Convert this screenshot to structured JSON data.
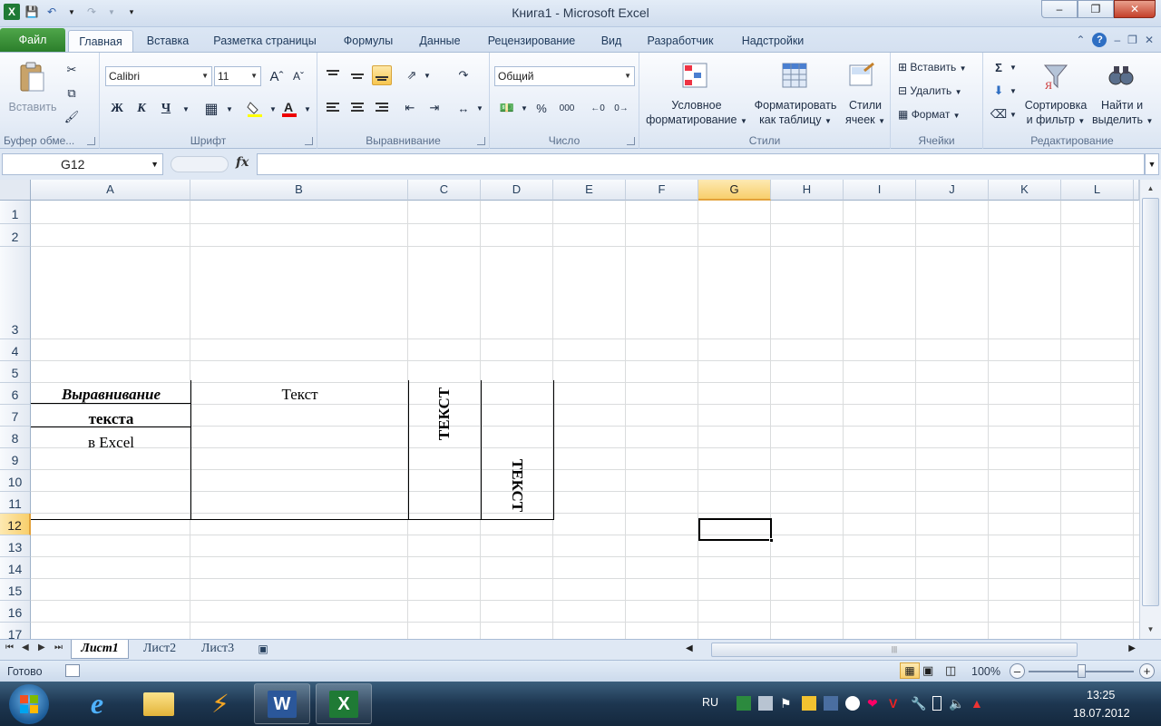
{
  "window": {
    "title": "Книга1 - Microsoft Excel",
    "min_glyph": "–",
    "restore_glyph": "❐",
    "close_glyph": "✕"
  },
  "tabs": [
    {
      "label": "Файл",
      "name": "tab-file"
    },
    {
      "label": "Главная",
      "name": "tab-home"
    },
    {
      "label": "Вставка",
      "name": "tab-insert"
    },
    {
      "label": "Разметка страницы",
      "name": "tab-page-layout"
    },
    {
      "label": "Формулы",
      "name": "tab-formulas"
    },
    {
      "label": "Данные",
      "name": "tab-data"
    },
    {
      "label": "Рецензирование",
      "name": "tab-review"
    },
    {
      "label": "Вид",
      "name": "tab-view"
    },
    {
      "label": "Разработчик",
      "name": "tab-developer"
    },
    {
      "label": "Надстройки",
      "name": "tab-addins"
    }
  ],
  "ribbon": {
    "clipboard": {
      "group_label": "Буфер обме...",
      "paste_label": "Вставить"
    },
    "font": {
      "group_label": "Шрифт",
      "font_name": "Calibri",
      "font_size": "11",
      "bold": "Ж",
      "italic": "К",
      "underline": "Ч"
    },
    "alignment": {
      "group_label": "Выравнивание"
    },
    "number": {
      "group_label": "Число",
      "format": "Общий",
      "percent": "%",
      "thousands": "000"
    },
    "styles": {
      "group_label": "Стили",
      "conditional_line1": "Условное",
      "conditional_line2": "форматирование",
      "table_line1": "Форматировать",
      "table_line2": "как таблицу",
      "cell_line1": "Стили",
      "cell_line2": "ячеек"
    },
    "cells": {
      "group_label": "Ячейки",
      "insert": "Вставить",
      "delete": "Удалить",
      "format": "Формат"
    },
    "editing": {
      "group_label": "Редактирование",
      "sort_line1": "Сортировка",
      "sort_line2": "и фильтр",
      "find_line1": "Найти и",
      "find_line2": "выделить"
    }
  },
  "formula_bar": {
    "name_box": "G12",
    "fx": "fx",
    "formula": ""
  },
  "columns": [
    "A",
    "B",
    "C",
    "D",
    "E",
    "F",
    "G",
    "H",
    "I",
    "J",
    "K",
    "L"
  ],
  "selected_column": "G",
  "rows": [
    "1",
    "2",
    "3",
    "4",
    "5",
    "6",
    "7",
    "8",
    "9",
    "10",
    "11",
    "12",
    "13",
    "14",
    "15",
    "16",
    "17"
  ],
  "selected_row": "12",
  "cells": {
    "A1": "Выравнивание",
    "A2": "текста",
    "A3": "в Excel",
    "B1": "Текст",
    "C1": "ТЕКСТ",
    "D3": "ТЕКСТ"
  },
  "sheets": [
    "Лист1",
    "Лист2",
    "Лист3"
  ],
  "active_sheet": "Лист1",
  "status": {
    "ready": "Готово",
    "zoom": "100%"
  },
  "taskbar": {
    "lang": "RU",
    "time": "13:25",
    "date": "18.07.2012"
  }
}
